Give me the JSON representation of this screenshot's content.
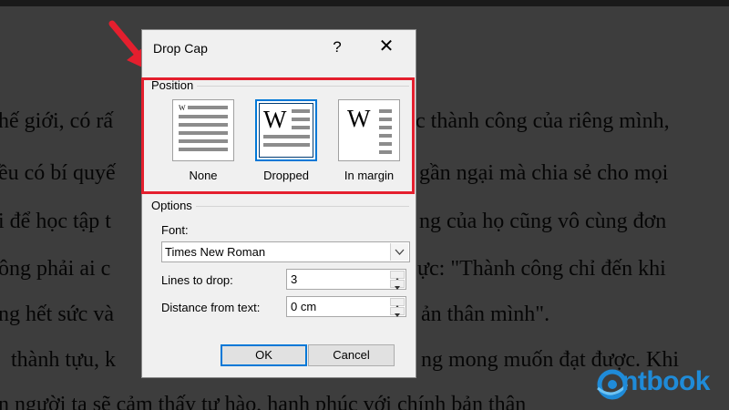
{
  "document": {
    "lines": [
      "hế giới, có rấ",
      "c thành công của riêng mình,",
      "ều có bí quyế",
      "gần ngại mà chia sẻ cho mọi",
      "i để học tập t",
      "ng của họ cũng vô cùng đơn",
      "ông phải ai c",
      "ực: \"Thành công chỉ đến khi",
      "ng hết sức và",
      "ản thân mình\".",
      "thành tựu, k",
      "ng mong muốn đạt được. Khi",
      "n người ta sẽ cảm thấy tự hào, hạnh phúc với chính bản thân"
    ]
  },
  "dialog": {
    "title": "Drop Cap",
    "help_label": "?",
    "close_label": "✕",
    "position": {
      "group_label": "Position",
      "options": [
        {
          "label": "None",
          "selected": false
        },
        {
          "label": "Dropped",
          "selected": true
        },
        {
          "label": "In margin",
          "selected": false
        }
      ],
      "glyph": "W"
    },
    "options": {
      "group_label": "Options",
      "font_label": "Font:",
      "font_value": "Times New Roman",
      "lines_label": "Lines to drop:",
      "lines_value": "3",
      "distance_label": "Distance from text:",
      "distance_value": "0 cm"
    },
    "ok_label": "OK",
    "cancel_label": "Cancel"
  },
  "annotation": {
    "highlight_color": "#e41f2e"
  },
  "logo": {
    "text": "ntbook",
    "color": "#1f8bd8"
  }
}
